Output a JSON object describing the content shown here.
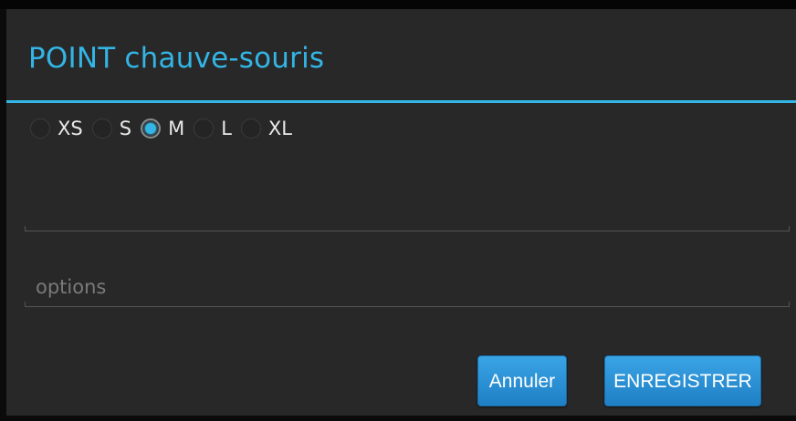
{
  "dialog": {
    "title": "POINT chauve-souris",
    "accent_color": "#33b5e5"
  },
  "size_options": [
    {
      "label": "XS",
      "checked": false
    },
    {
      "label": "S",
      "checked": false
    },
    {
      "label": "M",
      "checked": true
    },
    {
      "label": "L",
      "checked": false
    },
    {
      "label": "XL",
      "checked": false
    }
  ],
  "fields": {
    "name": {
      "value": "",
      "placeholder": ""
    },
    "options": {
      "value": "",
      "placeholder": "options"
    }
  },
  "buttons": {
    "cancel_label": "Annuler",
    "save_label": "ENREGISTRER",
    "color": "#2a8bd0"
  }
}
